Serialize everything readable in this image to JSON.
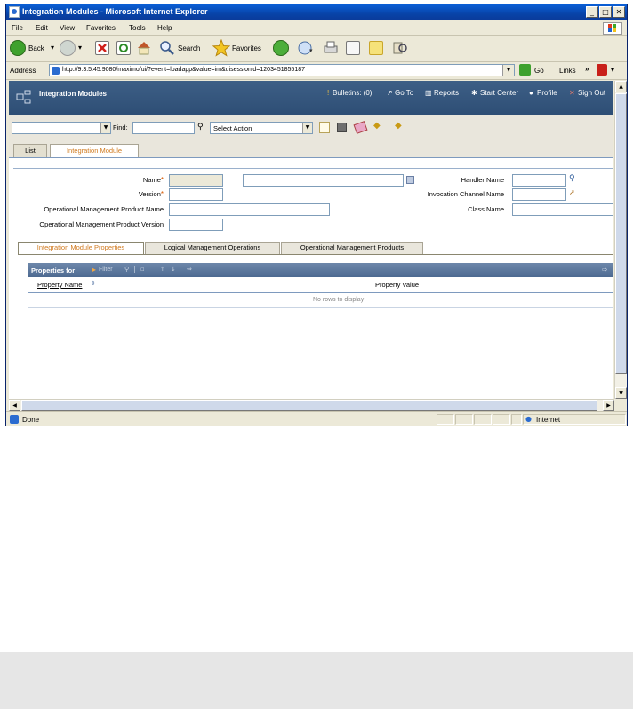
{
  "window": {
    "title": "Integration Modules - Microsoft Internet Explorer"
  },
  "menu": [
    "File",
    "Edit",
    "View",
    "Favorites",
    "Tools",
    "Help"
  ],
  "toolbar": {
    "back": "Back",
    "search": "Search",
    "favorites": "Favorites"
  },
  "address": {
    "label": "Address",
    "url": "http://9.3.5.45:9080/maximo/ui/?event=loadapp&value=im&uisessionid=1203451855187",
    "go": "Go",
    "links": "Links"
  },
  "app": {
    "title": "Integration Modules",
    "links": [
      "Bulletins: (0)",
      "Go To",
      "Reports",
      "Start Center",
      "Profile",
      "Sign Out"
    ]
  },
  "actions": {
    "find_label": "Find:",
    "select_action": "Select Action"
  },
  "tabs": [
    {
      "label": "List"
    },
    {
      "label": "Integration Module"
    }
  ],
  "form": {
    "name_label": "Name",
    "version_label": "Version",
    "omp_name_label": "Operational Management Product Name",
    "omp_version_label": "Operational Management Product Version",
    "handler_label": "Handler Name",
    "invocation_label": "Invocation Channel Name",
    "class_label": "Class Name"
  },
  "subtabs": [
    {
      "label": "Integration Module Properties"
    },
    {
      "label": "Logical Management Operations"
    },
    {
      "label": "Operational Management Products"
    }
  ],
  "table": {
    "title": "Properties for",
    "filter": "Filter",
    "columns": [
      "Property Name",
      "Property Value"
    ],
    "empty": "No rows to display"
  },
  "status": {
    "left": "Done",
    "zone": "Internet"
  },
  "colors": {
    "title_bar": "#0843a8",
    "app_header": "#2e4e75",
    "accent_orange": "#d07a1f"
  }
}
